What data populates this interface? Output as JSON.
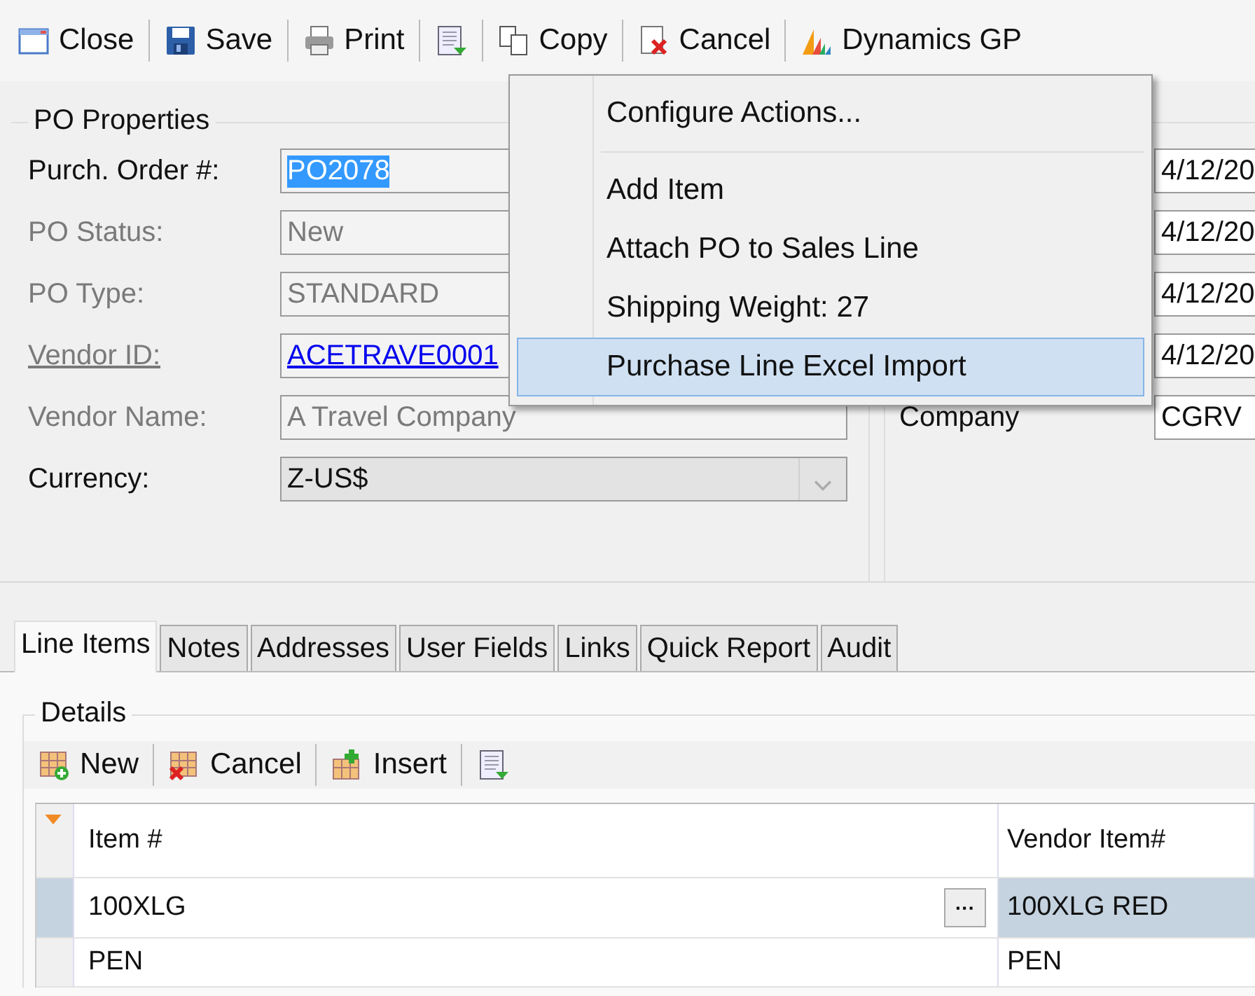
{
  "toolbar": [
    {
      "kind": "close",
      "label": "Close"
    },
    {
      "kind": "save",
      "label": "Save"
    },
    {
      "kind": "print",
      "label": "Print"
    },
    {
      "kind": "actions"
    },
    {
      "kind": "copy",
      "label": "Copy"
    },
    {
      "kind": "cancel",
      "label": "Cancel"
    },
    {
      "kind": "dynamics",
      "label": "Dynamics GP"
    }
  ],
  "po_properties": {
    "title": "PO Properties",
    "fields": [
      {
        "label": "Purch. Order #:",
        "value": "PO2078",
        "kind": "text",
        "disabled": false,
        "text_selected": true
      },
      {
        "label": "PO Status:",
        "value": "New",
        "kind": "text",
        "disabled": true,
        "text_selected": false
      },
      {
        "label": "PO Type:",
        "value": "STANDARD",
        "kind": "text",
        "disabled": true,
        "text_selected": false
      },
      {
        "label": "Vendor ID:",
        "value": "ACETRAVE0001",
        "kind": "link",
        "disabled": true,
        "text_selected": false
      },
      {
        "label": "Vendor Name:",
        "value": "A Travel Company",
        "kind": "text",
        "disabled": true,
        "text_selected": false
      },
      {
        "label": "Currency:",
        "value": "Z-US$",
        "kind": "dropdown",
        "disabled": false,
        "text_selected": false
      }
    ]
  },
  "dates_panel": {
    "fields": [
      {
        "value": "4/12/20"
      },
      {
        "value": "4/12/20"
      },
      {
        "value": "4/12/20"
      },
      {
        "value": "4/12/20"
      },
      {
        "label": "Company",
        "value": "CGRV"
      }
    ]
  },
  "actions_menu": [
    {
      "kind": "item",
      "label": "Configure Actions...",
      "selected": false
    },
    {
      "kind": "separator"
    },
    {
      "kind": "item",
      "label": "Add Item",
      "selected": false
    },
    {
      "kind": "item",
      "label": "Attach PO to Sales Line",
      "selected": false
    },
    {
      "kind": "item",
      "label": "Shipping Weight: 27",
      "selected": false
    },
    {
      "kind": "item",
      "label": "Purchase Line Excel Import",
      "selected": true
    }
  ],
  "tabs": [
    {
      "label": "Line Items",
      "selected": true
    },
    {
      "label": "Notes",
      "selected": false
    },
    {
      "label": "Addresses",
      "selected": false
    },
    {
      "label": "User Fields",
      "selected": false
    },
    {
      "label": "Links",
      "selected": false
    },
    {
      "label": "Quick Report",
      "selected": false
    },
    {
      "label": "Audit",
      "selected": false
    }
  ],
  "details": {
    "title": "Details",
    "toolbar": [
      {
        "kind": "new",
        "label": "New"
      },
      {
        "kind": "cancel",
        "label": "Cancel"
      },
      {
        "kind": "insert",
        "label": "Insert"
      },
      {
        "kind": "actions"
      }
    ],
    "grid": {
      "columns": [
        "Item #",
        "Vendor Item#"
      ],
      "rows": [
        {
          "cells": [
            "100XLG",
            "100XLG RED"
          ],
          "selected": true,
          "editor_button": "···"
        },
        {
          "cells": [
            "PEN",
            "PEN"
          ],
          "selected": false
        }
      ]
    }
  }
}
